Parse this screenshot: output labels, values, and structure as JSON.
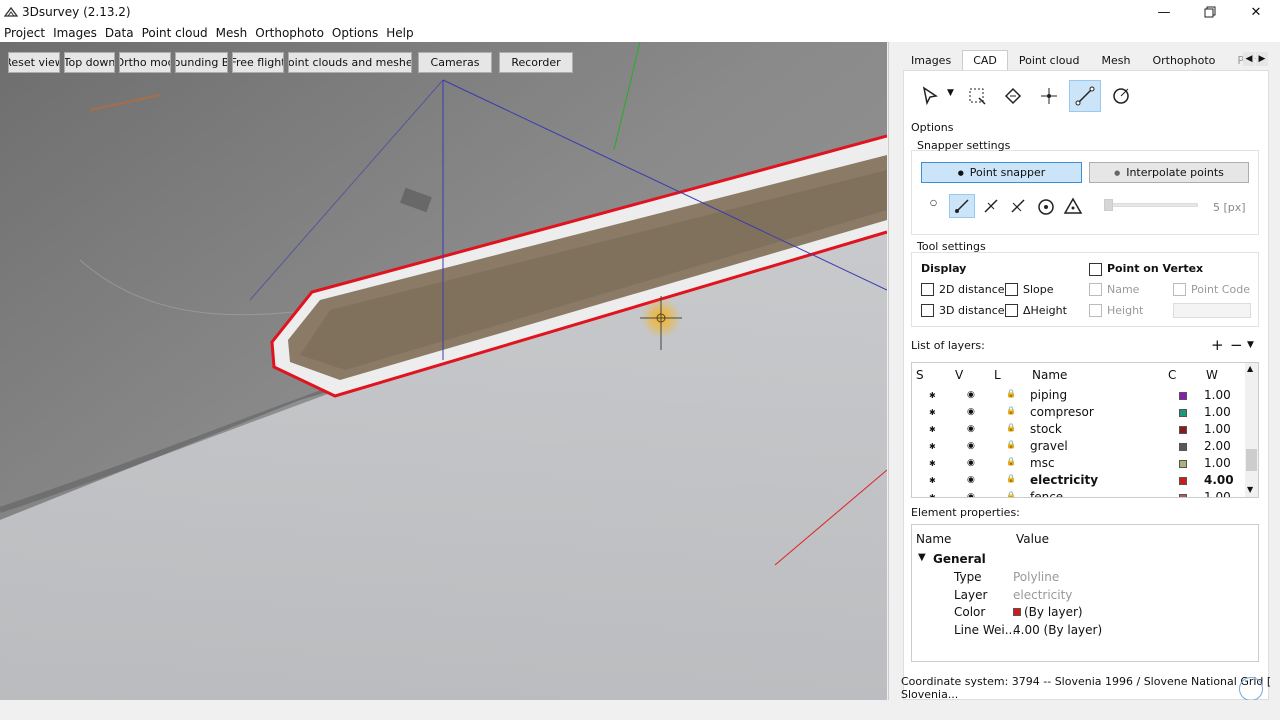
{
  "window": {
    "title": "3Dsurvey (2.13.2)"
  },
  "menu": [
    "Project",
    "Images",
    "Data",
    "Point cloud",
    "Mesh",
    "Orthophoto",
    "Options",
    "Help"
  ],
  "toolbar": [
    "Reset view",
    "Top down",
    "Ortho mod",
    "ounding B",
    "Free flight",
    "Point clouds and meshes",
    "Cameras",
    "Recorder"
  ],
  "tabs": [
    "Images",
    "CAD",
    "Point cloud",
    "Mesh",
    "Orthophoto",
    "Profi"
  ],
  "cad_tools": [
    "select-arrow-icon",
    "dropdown-arrow-icon",
    "rect-select-icon",
    "tag-icon",
    "crosshair-icon",
    "polyline-icon",
    "circle-line-icon"
  ],
  "options": {
    "title": "Options",
    "snapper_title": "Snapper settings",
    "point_snapper": "Point snapper",
    "interpolate": "Interpolate points",
    "snap_value": "5 [px]",
    "tool_title": "Tool settings",
    "display": "Display",
    "point_on_vertex": "Point on Vertex",
    "cb_2d": "2D distance",
    "cb_slope": "Slope",
    "cb_name": "Name",
    "cb_pointcode": "Point Code",
    "cb_3d": "3D distance",
    "cb_dheight": "ΔHeight",
    "cb_height": "Height"
  },
  "layers": {
    "title": "List of layers:",
    "headers": {
      "s": "S",
      "v": "V",
      "l": "L",
      "name": "Name",
      "c": "C",
      "w": "W"
    },
    "rows": [
      {
        "name": "piping",
        "color": "#8e1ab5",
        "w": "1.00",
        "bold": false
      },
      {
        "name": "compresor",
        "color": "#1a9a7c",
        "w": "1.00",
        "bold": false
      },
      {
        "name": "stock",
        "color": "#8b1a1a",
        "w": "1.00",
        "bold": false
      },
      {
        "name": "gravel",
        "color": "#595959",
        "w": "2.00",
        "bold": false
      },
      {
        "name": "msc",
        "color": "#a9b07a",
        "w": "1.00",
        "bold": false
      },
      {
        "name": "electricity",
        "color": "#d11a1a",
        "w": "4.00",
        "bold": true
      },
      {
        "name": "fence",
        "color": "#b05a6a",
        "w": "1.00",
        "bold": false
      }
    ]
  },
  "props": {
    "title": "Element properties:",
    "h_name": "Name",
    "h_value": "Value",
    "group": "General",
    "rows": [
      {
        "k": "Type",
        "v": "Polyline",
        "grey": true
      },
      {
        "k": "Layer",
        "v": "electricity",
        "grey": true
      },
      {
        "k": "Color",
        "v": "(By layer)",
        "grey": false,
        "swatch": "#d11a1a"
      },
      {
        "k": "Line Wei...",
        "v": "4.00 (By layer)",
        "grey": false
      }
    ]
  },
  "status": "Coordinate system: 3794 -- Slovenia 1996 / Slovene National Grid [ Slovenia..."
}
